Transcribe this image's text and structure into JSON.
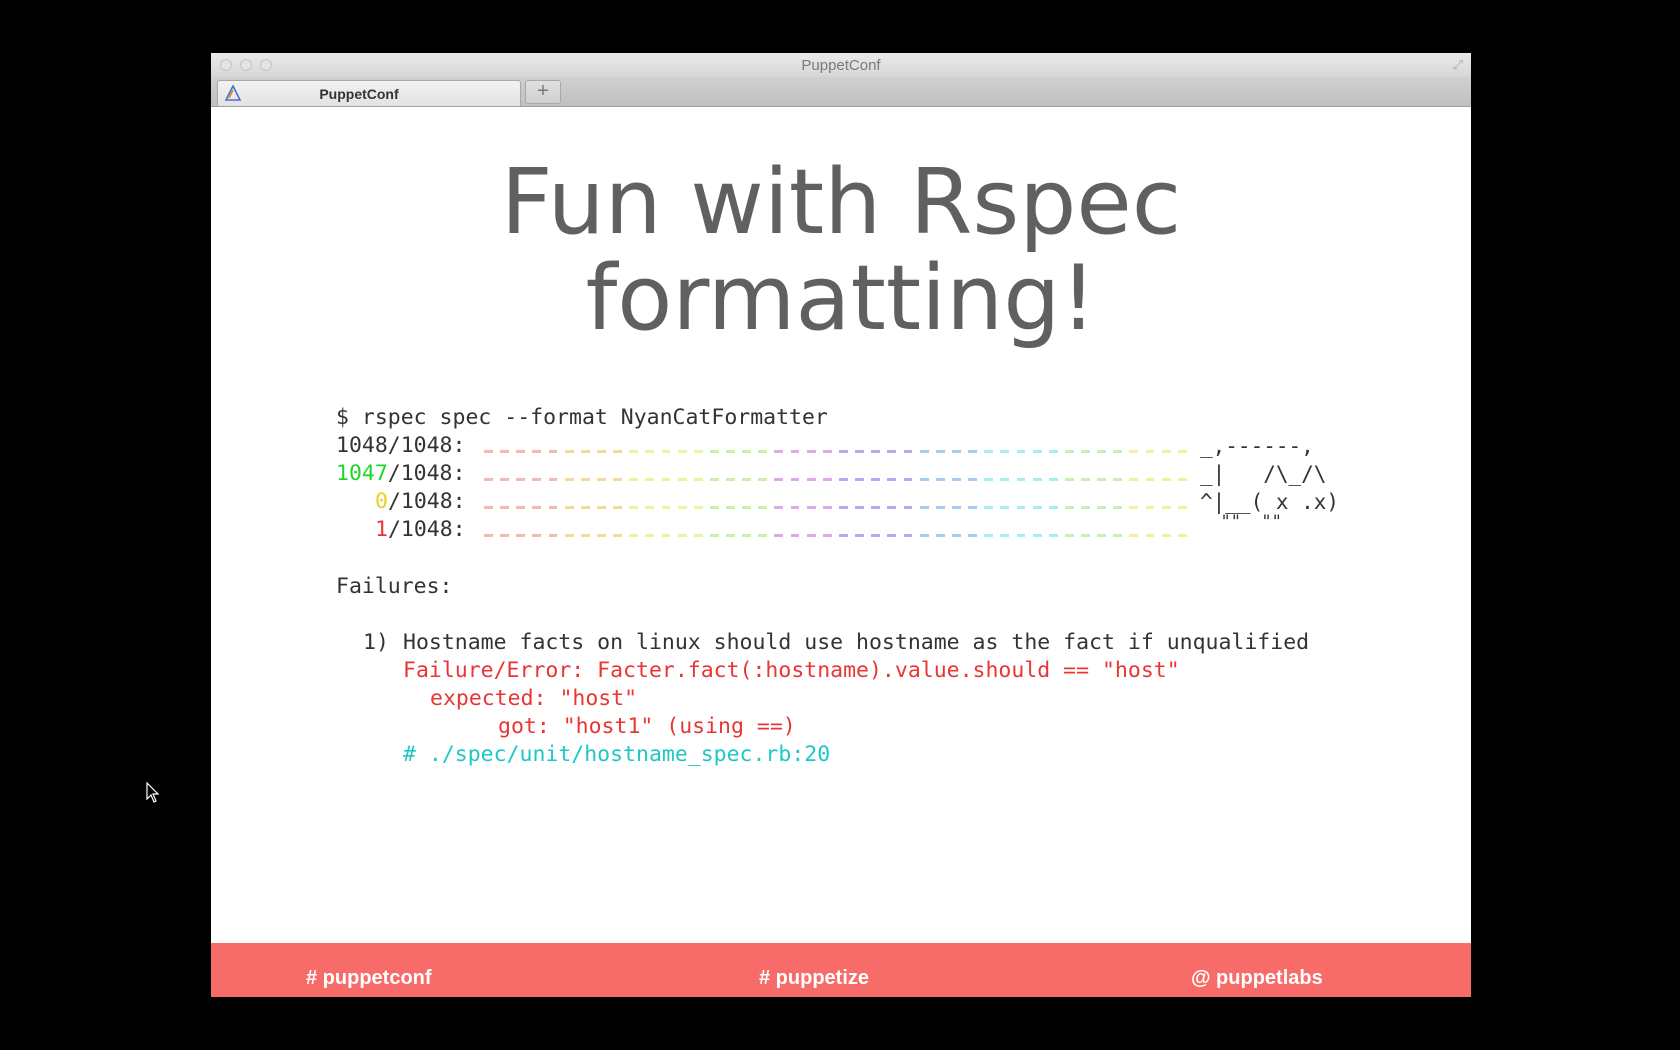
{
  "window": {
    "title": "PuppetConf"
  },
  "tabs": [
    {
      "label": "PuppetConf"
    }
  ],
  "new_tab_label": "+",
  "slide": {
    "title_line1": "Fun with Rspec",
    "title_line2": "formatting!"
  },
  "terminal": {
    "command": "$ rspec spec --format NyanCatFormatter",
    "counts": [
      {
        "num": "1048",
        "total": "/1048:"
      },
      {
        "num": "1047",
        "total": "/1048:"
      },
      {
        "num": "0",
        "total": "/1048:"
      },
      {
        "num": "1",
        "total": "/1048:"
      }
    ],
    "cat_lines": [
      "_,------,",
      "_|   /\\_/\\",
      "^|__( x .x)",
      "  \"\"  \"\""
    ],
    "failures_heading": "Failures:",
    "failure": {
      "number": "1)",
      "description": "Hostname facts on linux should use hostname as the fact if unqualified",
      "error": "Failure/Error: Facter.fact(:hostname).value.should == \"host\"",
      "expected": "expected: \"host\"",
      "got": "got: \"host1\" (using ==)",
      "location": "# ./spec/unit/hostname_spec.rb:20"
    }
  },
  "footer": {
    "left": "# puppetconf",
    "center": "# puppetize",
    "right": "@ puppetlabs"
  },
  "colors": {
    "footer_bg": "#f76b69",
    "pass_green": "#1ed62b",
    "pending_yellow": "#ead21f",
    "fail_red": "#e83535",
    "comment_cyan": "#1fc7c7"
  }
}
